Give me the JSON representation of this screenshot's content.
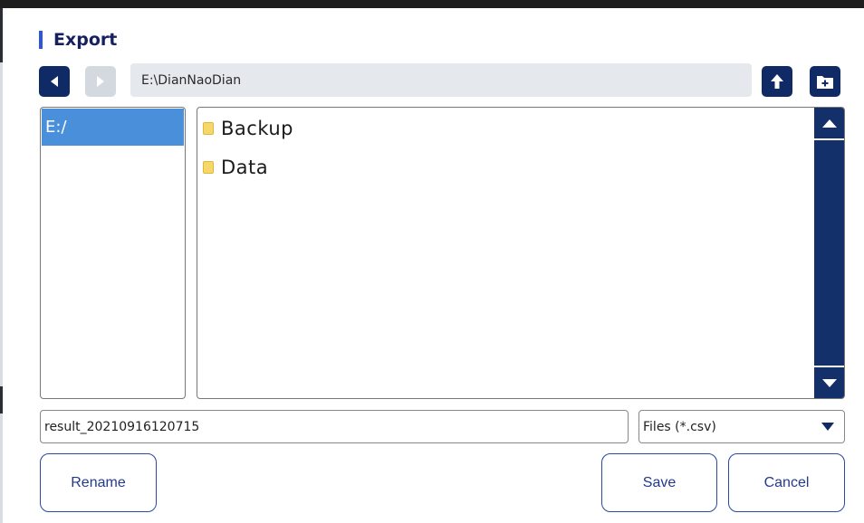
{
  "dialog": {
    "title": "Export",
    "path": "E:\\DianNaoDian",
    "drives": [
      {
        "label": "E:/"
      }
    ],
    "files": [
      {
        "name": "Backup",
        "icon": "folder-icon"
      },
      {
        "name": "Data",
        "icon": "folder-icon"
      }
    ],
    "filename_value": "result_20210916120715",
    "filetype_selected": "Files (*.csv)",
    "buttons": {
      "rename": "Rename",
      "save": "Save",
      "cancel": "Cancel"
    },
    "nav_icons": {
      "back": "arrow-left-icon",
      "forward": "arrow-right-icon",
      "up": "arrow-up-icon",
      "new_folder": "new-folder-icon"
    }
  },
  "colors": {
    "accent": "#2f56d6",
    "navy": "#102a66",
    "scrollbar": "#14306b",
    "selection": "#4a8fd9",
    "button_text": "#233a8c",
    "folder": "#f5d76c"
  }
}
